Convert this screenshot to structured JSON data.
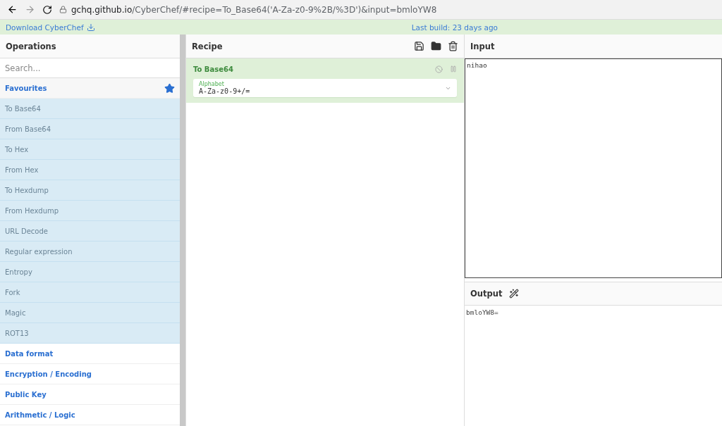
{
  "browser": {
    "url_host": "gchq.github.io",
    "url_path": "/CyberChef/#recipe=To_Base64('A-Za-z0-9%2B/%3D')&input=bmloYW8"
  },
  "banner": {
    "download": "Download CyberChef",
    "last_build": "Last build: 23 days ago"
  },
  "operations": {
    "title": "Operations",
    "search": {
      "placeholder": "Search..."
    },
    "categories": [
      {
        "name": "Favourites",
        "items": [
          "To Base64",
          "From Base64",
          "To Hex",
          "From Hex",
          "To Hexdump",
          "From Hexdump",
          "URL Decode",
          "Regular expression",
          "Entropy",
          "Fork",
          "Magic",
          "ROT13"
        ]
      },
      {
        "name": "Data format"
      },
      {
        "name": "Encryption / Encoding"
      },
      {
        "name": "Public Key"
      },
      {
        "name": "Arithmetic / Logic"
      }
    ]
  },
  "recipe": {
    "title": "Recipe",
    "steps": [
      {
        "name": "To Base64",
        "disabled": false,
        "paused": false,
        "argument": {
          "label": "Alphabet",
          "value": "A-Za-z0-9+/="
        }
      }
    ]
  },
  "input": {
    "title": "Input",
    "value": "nihao"
  },
  "output": {
    "title": "Output",
    "value": "bmloYW8="
  }
}
